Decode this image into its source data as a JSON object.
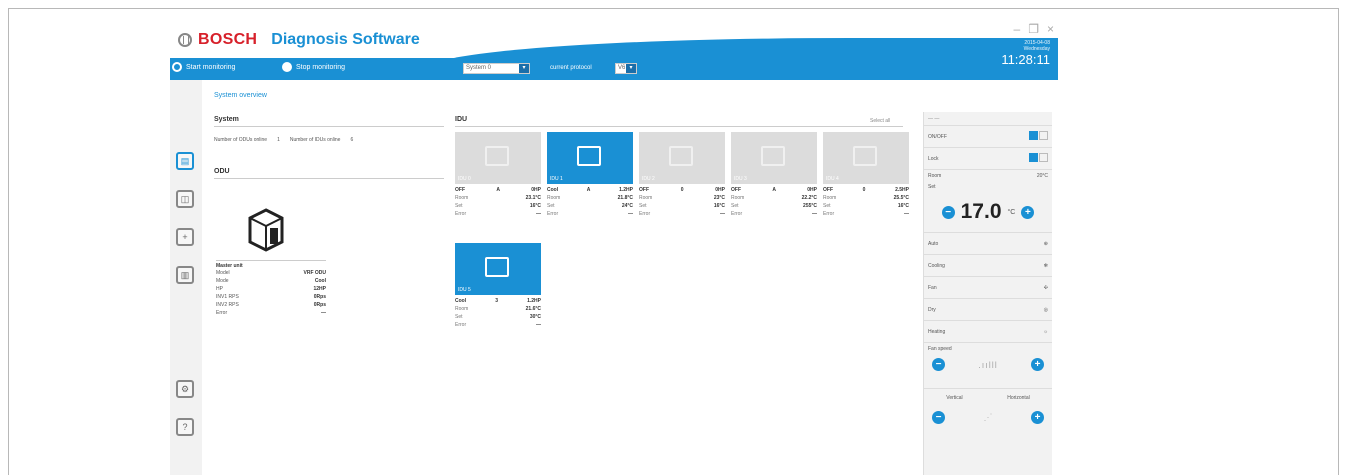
{
  "app": {
    "brand": "BOSCH",
    "product": "Diagnosis Software",
    "date": "2015-04-08",
    "day": "Wednesday",
    "time": "11:28:11"
  },
  "window": {
    "minimize": "–",
    "maximize": "❐",
    "close": "×"
  },
  "toolbar": {
    "start": "Start monitoring",
    "stop": "Stop monitoring",
    "system_select": "System 0",
    "protocol_label": "current protocol",
    "protocol_value": "V6"
  },
  "breadcrumb": "System overview",
  "system": {
    "title": "System",
    "odu_online_label": "Number of ODUs online",
    "odu_online": "1",
    "idu_online_label": "Number of IDUs online",
    "idu_online": "6"
  },
  "odu": {
    "title": "ODU",
    "card_title": "Master unit",
    "rows": [
      {
        "label": "Model",
        "value": "VRF ODU"
      },
      {
        "label": "Mode",
        "value": "Cool"
      },
      {
        "label": "HP",
        "value": "12HP"
      },
      {
        "label": "INV1 RPS",
        "value": "0Rps"
      },
      {
        "label": "INV2 RPS",
        "value": "0Rps"
      },
      {
        "label": "Error",
        "value": "—"
      }
    ]
  },
  "idu": {
    "title": "IDU",
    "select_all": "Select all",
    "units": [
      {
        "name": "IDU 0",
        "state": "OFF",
        "mode": "A",
        "hp": "0HP",
        "room": "23.1°C",
        "set": "16°C",
        "error": "—",
        "active": false
      },
      {
        "name": "IDU 1",
        "state": "Cool",
        "mode": "A",
        "hp": "1.2HP",
        "room": "21.8°C",
        "set": "24°C",
        "error": "—",
        "active": true
      },
      {
        "name": "IDU 2",
        "state": "OFF",
        "mode": "0",
        "hp": "0HP",
        "room": "23°C",
        "set": "16°C",
        "error": "—",
        "active": false
      },
      {
        "name": "IDU 3",
        "state": "OFF",
        "mode": "A",
        "hp": "0HP",
        "room": "22.2°C",
        "set": "255°C",
        "error": "—",
        "active": false
      },
      {
        "name": "IDU 4",
        "state": "OFF",
        "mode": "0",
        "hp": "2.5HP",
        "room": "25.5°C",
        "set": "16°C",
        "error": "—",
        "active": false
      },
      {
        "name": "IDU 5",
        "state": "Cool",
        "mode": "3",
        "hp": "1.2HP",
        "room": "21.6°C",
        "set": "30°C",
        "error": "—",
        "active": true
      }
    ],
    "labels": {
      "room": "Room",
      "set": "Set",
      "error": "Error"
    }
  },
  "control": {
    "onoff": "ON/OFF",
    "lock": "Lock",
    "room_label": "Room",
    "room_value": "20°C",
    "set_label": "Set",
    "temp": "17.0",
    "unit": "°C",
    "modes": [
      "Auto",
      "Cooling",
      "Fan",
      "Dry",
      "Heating"
    ],
    "fan_speed": "Fan speed",
    "vertical": "Vertical",
    "horizontal": "Horizontal"
  }
}
